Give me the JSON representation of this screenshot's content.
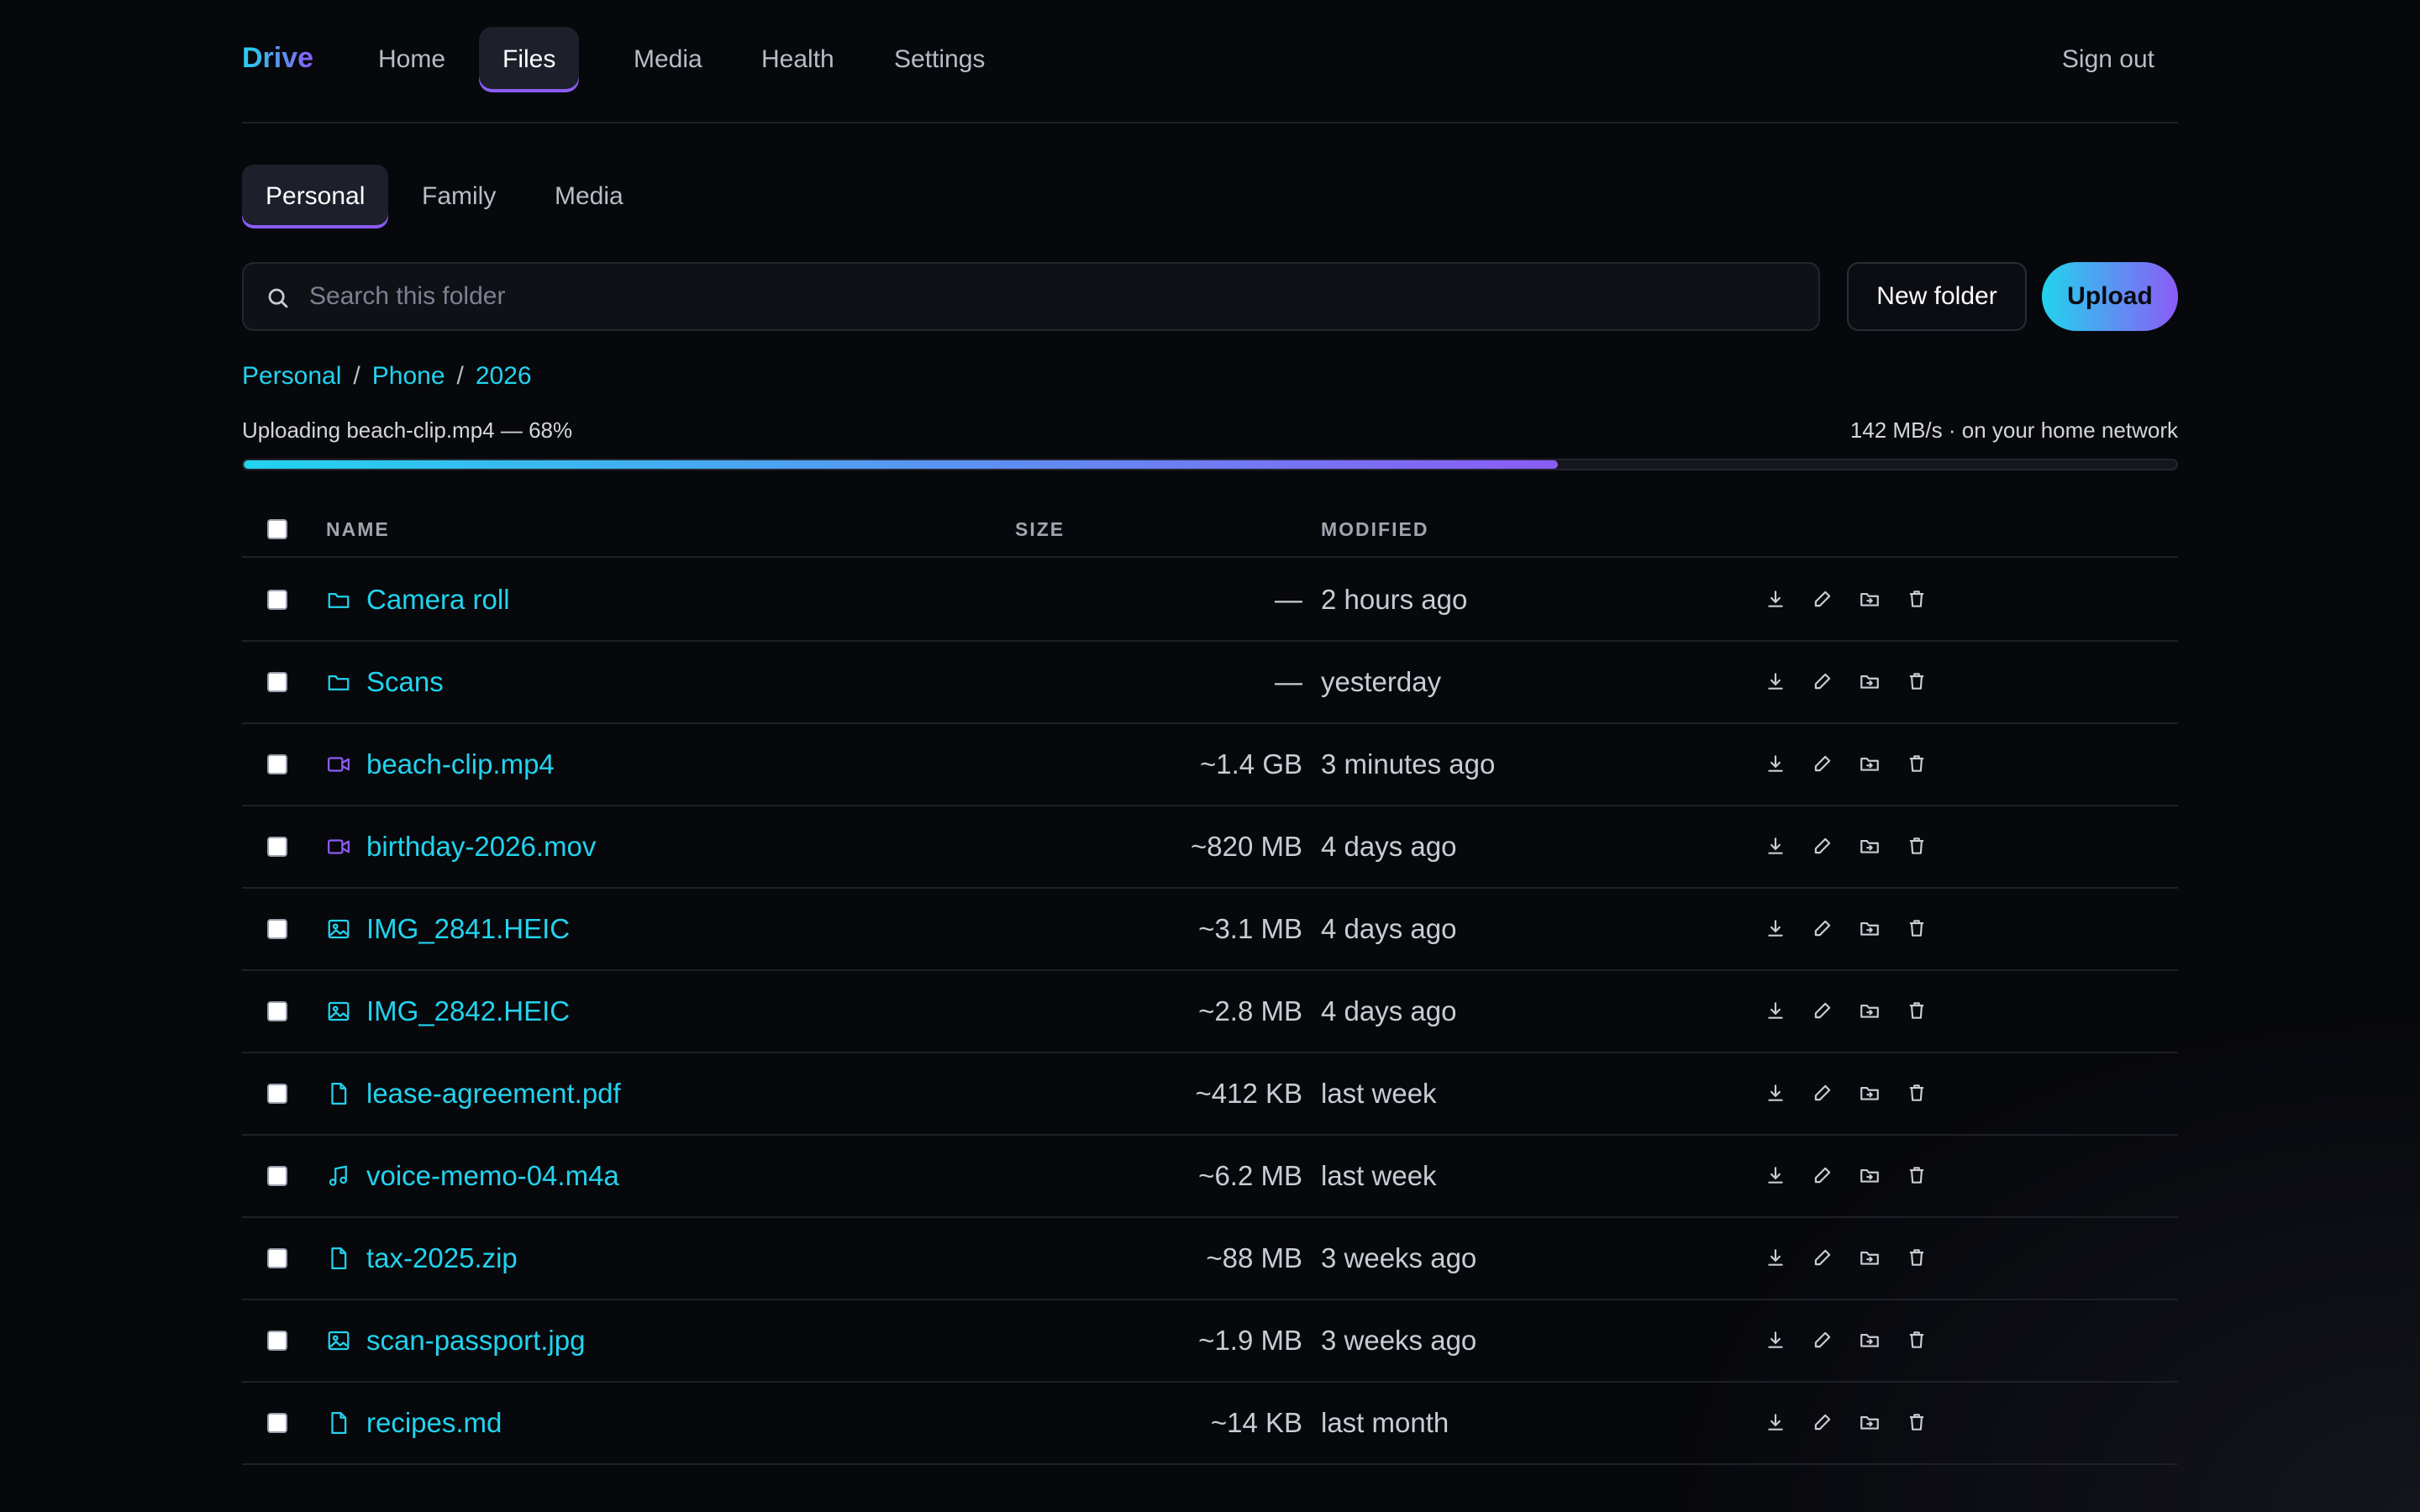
{
  "nav": {
    "logo": "Drive",
    "links": [
      "Home",
      "Files",
      "Media",
      "Health",
      "Settings"
    ],
    "active": "Files",
    "sign_out": "Sign out"
  },
  "tabs": {
    "items": [
      "Personal",
      "Family",
      "Media"
    ],
    "active": "Personal"
  },
  "toolbar": {
    "search_placeholder": "Search this folder",
    "search_value": "",
    "new_folder_label": "New folder",
    "upload_label": "Upload"
  },
  "breadcrumb": [
    "Personal",
    "Phone",
    "2026"
  ],
  "upload": {
    "status": "Uploading beach-clip.mp4 — 68%",
    "speed": "142 MB/s · on your home network",
    "progress": 0.68
  },
  "table": {
    "headers": {
      "name": "NAME",
      "size": "SIZE",
      "modified": "MODIFIED"
    },
    "rows": [
      {
        "icon": "folder-icon",
        "name": "Camera roll",
        "size": "—",
        "modified": "2 hours ago"
      },
      {
        "icon": "folder-icon",
        "name": "Scans",
        "size": "—",
        "modified": "yesterday"
      },
      {
        "icon": "video-icon",
        "name": "beach-clip.mp4",
        "size": "~1.4 GB",
        "modified": "3 minutes ago"
      },
      {
        "icon": "video-icon",
        "name": "birthday-2026.mov",
        "size": "~820 MB",
        "modified": "4 days ago"
      },
      {
        "icon": "image-icon",
        "name": "IMG_2841.HEIC",
        "size": "~3.1 MB",
        "modified": "4 days ago"
      },
      {
        "icon": "image-icon",
        "name": "IMG_2842.HEIC",
        "size": "~2.8 MB",
        "modified": "4 days ago"
      },
      {
        "icon": "document-icon",
        "name": "lease-agreement.pdf",
        "size": "~412 KB",
        "modified": "last week"
      },
      {
        "icon": "music-icon",
        "name": "voice-memo-04.m4a",
        "size": "~6.2 MB",
        "modified": "last week"
      },
      {
        "icon": "document-icon",
        "name": "tax-2025.zip",
        "size": "~88 MB",
        "modified": "3 weeks ago"
      },
      {
        "icon": "image-icon",
        "name": "scan-passport.jpg",
        "size": "~1.9 MB",
        "modified": "3 weeks ago"
      },
      {
        "icon": "document-icon",
        "name": "recipes.md",
        "size": "~14 KB",
        "modified": "last month"
      }
    ],
    "actions": [
      "download-icon",
      "rename-icon",
      "move-icon",
      "trash-icon"
    ]
  },
  "colors": {
    "accent_cyan": "#22d3ee",
    "accent_violet": "#8b5cf6",
    "background": "#07080c"
  }
}
